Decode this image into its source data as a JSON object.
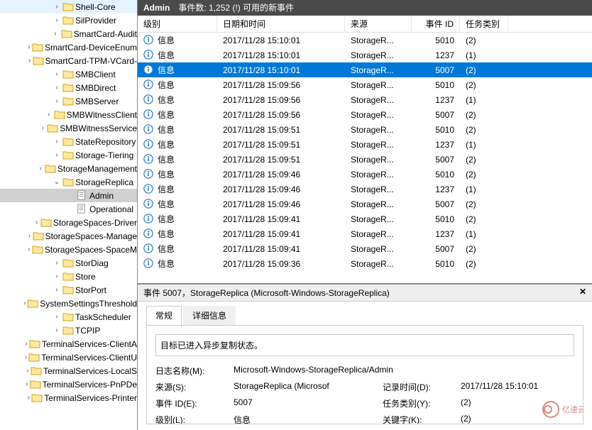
{
  "header": {
    "title": "Admin",
    "summary": "事件数: 1,252 (!) 可用的新事件"
  },
  "columns": {
    "level": "级别",
    "datetime": "日期和时间",
    "source": "来源",
    "eventid": "事件 ID",
    "taskcat": "任务类别"
  },
  "tree": [
    {
      "label": "Shell-Core",
      "indent": 72,
      "exp": "›",
      "type": "folder"
    },
    {
      "label": "SilProvider",
      "indent": 72,
      "exp": "›",
      "type": "folder"
    },
    {
      "label": "SmartCard-Audit",
      "indent": 72,
      "exp": "›",
      "type": "folder"
    },
    {
      "label": "SmartCard-DeviceEnum",
      "indent": 72,
      "exp": "›",
      "type": "folder"
    },
    {
      "label": "SmartCard-TPM-VCard-",
      "indent": 72,
      "exp": "›",
      "type": "folder"
    },
    {
      "label": "SMBClient",
      "indent": 72,
      "exp": "›",
      "type": "folder"
    },
    {
      "label": "SMBDirect",
      "indent": 72,
      "exp": "›",
      "type": "folder"
    },
    {
      "label": "SMBServer",
      "indent": 72,
      "exp": "›",
      "type": "folder"
    },
    {
      "label": "SMBWitnessClient",
      "indent": 72,
      "exp": "›",
      "type": "folder"
    },
    {
      "label": "SMBWitnessService",
      "indent": 72,
      "exp": "›",
      "type": "folder"
    },
    {
      "label": "StateRepository",
      "indent": 72,
      "exp": "›",
      "type": "folder"
    },
    {
      "label": "Storage-Tiering",
      "indent": 72,
      "exp": "›",
      "type": "folder"
    },
    {
      "label": "StorageManagement",
      "indent": 72,
      "exp": "›",
      "type": "folder"
    },
    {
      "label": "StorageReplica",
      "indent": 72,
      "exp": "⌄",
      "type": "folder"
    },
    {
      "label": "Admin",
      "indent": 92,
      "exp": "",
      "type": "log",
      "selected": true
    },
    {
      "label": "Operational",
      "indent": 92,
      "exp": "",
      "type": "log"
    },
    {
      "label": "StorageSpaces-Driver",
      "indent": 72,
      "exp": "›",
      "type": "folder"
    },
    {
      "label": "StorageSpaces-Manage",
      "indent": 72,
      "exp": "›",
      "type": "folder"
    },
    {
      "label": "StorageSpaces-SpaceM",
      "indent": 72,
      "exp": "›",
      "type": "folder"
    },
    {
      "label": "StorDiag",
      "indent": 72,
      "exp": "›",
      "type": "folder"
    },
    {
      "label": "Store",
      "indent": 72,
      "exp": "›",
      "type": "folder"
    },
    {
      "label": "StorPort",
      "indent": 72,
      "exp": "›",
      "type": "folder"
    },
    {
      "label": "SystemSettingsThreshold",
      "indent": 72,
      "exp": "›",
      "type": "folder"
    },
    {
      "label": "TaskScheduler",
      "indent": 72,
      "exp": "›",
      "type": "folder"
    },
    {
      "label": "TCPIP",
      "indent": 72,
      "exp": "›",
      "type": "folder"
    },
    {
      "label": "TerminalServices-ClientA",
      "indent": 72,
      "exp": "›",
      "type": "folder"
    },
    {
      "label": "TerminalServices-ClientU",
      "indent": 72,
      "exp": "›",
      "type": "folder"
    },
    {
      "label": "TerminalServices-LocalS",
      "indent": 72,
      "exp": "›",
      "type": "folder"
    },
    {
      "label": "TerminalServices-PnPDe",
      "indent": 72,
      "exp": "›",
      "type": "folder"
    },
    {
      "label": "TerminalServices-Printer",
      "indent": 72,
      "exp": "›",
      "type": "folder"
    }
  ],
  "events": [
    {
      "level": "信息",
      "dt": "2017/11/28 15:10:01",
      "src": "StorageR...",
      "id": "5010",
      "tc": "(2)"
    },
    {
      "level": "信息",
      "dt": "2017/11/28 15:10:01",
      "src": "StorageR...",
      "id": "1237",
      "tc": "(1)"
    },
    {
      "level": "信息",
      "dt": "2017/11/28 15:10:01",
      "src": "StorageR...",
      "id": "5007",
      "tc": "(2)",
      "selected": true
    },
    {
      "level": "信息",
      "dt": "2017/11/28 15:09:56",
      "src": "StorageR...",
      "id": "5010",
      "tc": "(2)"
    },
    {
      "level": "信息",
      "dt": "2017/11/28 15:09:56",
      "src": "StorageR...",
      "id": "1237",
      "tc": "(1)"
    },
    {
      "level": "信息",
      "dt": "2017/11/28 15:09:56",
      "src": "StorageR...",
      "id": "5007",
      "tc": "(2)"
    },
    {
      "level": "信息",
      "dt": "2017/11/28 15:09:51",
      "src": "StorageR...",
      "id": "5010",
      "tc": "(2)"
    },
    {
      "level": "信息",
      "dt": "2017/11/28 15:09:51",
      "src": "StorageR...",
      "id": "1237",
      "tc": "(1)"
    },
    {
      "level": "信息",
      "dt": "2017/11/28 15:09:51",
      "src": "StorageR...",
      "id": "5007",
      "tc": "(2)"
    },
    {
      "level": "信息",
      "dt": "2017/11/28 15:09:46",
      "src": "StorageR...",
      "id": "5010",
      "tc": "(2)"
    },
    {
      "level": "信息",
      "dt": "2017/11/28 15:09:46",
      "src": "StorageR...",
      "id": "1237",
      "tc": "(1)"
    },
    {
      "level": "信息",
      "dt": "2017/11/28 15:09:46",
      "src": "StorageR...",
      "id": "5007",
      "tc": "(2)"
    },
    {
      "level": "信息",
      "dt": "2017/11/28 15:09:41",
      "src": "StorageR...",
      "id": "5010",
      "tc": "(2)"
    },
    {
      "level": "信息",
      "dt": "2017/11/28 15:09:41",
      "src": "StorageR...",
      "id": "1237",
      "tc": "(1)"
    },
    {
      "level": "信息",
      "dt": "2017/11/28 15:09:41",
      "src": "StorageR...",
      "id": "5007",
      "tc": "(2)"
    },
    {
      "level": "信息",
      "dt": "2017/11/28 15:09:36",
      "src": "StorageR...",
      "id": "5010",
      "tc": "(2)"
    }
  ],
  "detail": {
    "header": "事件 5007，StorageReplica (Microsoft-Windows-StorageReplica)",
    "tab_general": "常规",
    "tab_details": "详细信息",
    "message": "目标已进入异步复制状态。",
    "labels": {
      "logname": "日志名称(M):",
      "source": "来源(S):",
      "eventid": "事件 ID(E):",
      "level": "级别(L):",
      "logtime": "记录时间(D):",
      "taskcat": "任务类别(Y):",
      "keywords": "关键字(K):"
    },
    "values": {
      "logname": "Microsoft-Windows-StorageReplica/Admin",
      "source": "StorageReplica (Microsof",
      "eventid": "5007",
      "level": "信息",
      "logtime": "2017/11/28 15:10:01",
      "taskcat": "(2)",
      "keywords": "(2)"
    }
  },
  "watermark": "亿速云"
}
